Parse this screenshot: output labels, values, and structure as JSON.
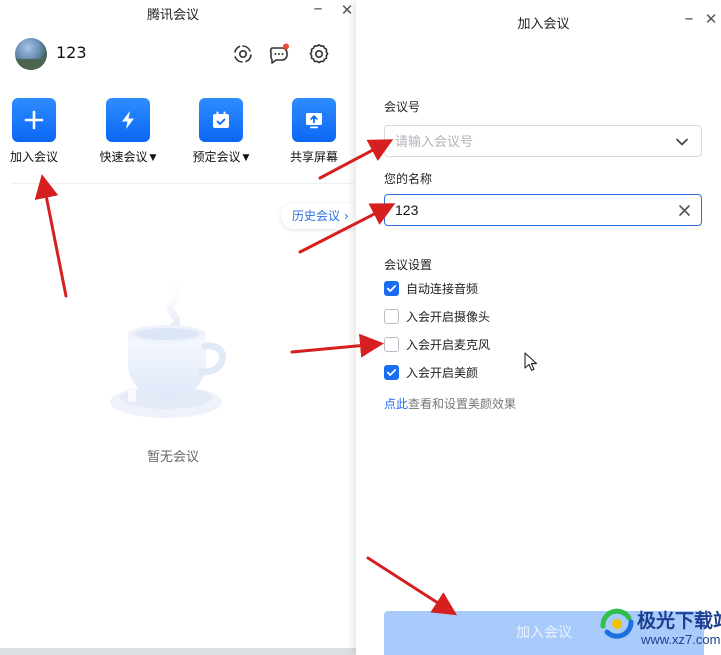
{
  "main_window": {
    "title": "腾讯会议",
    "username": "123",
    "quick_actions": {
      "join": "加入会议",
      "quick": "快速会议",
      "schedule": "预定会议",
      "share": "共享屏幕"
    },
    "history_button": "历史会议",
    "empty_state": "暂无会议"
  },
  "join_dialog": {
    "title": "加入会议",
    "meeting_number_label": "会议号",
    "meeting_number_placeholder": "请输入会议号",
    "meeting_number_value": "",
    "name_label": "您的名称",
    "name_value": "123",
    "settings_label": "会议设置",
    "options": [
      {
        "label": "自动连接音频",
        "checked": true
      },
      {
        "label": "入会开启摄像头",
        "checked": false
      },
      {
        "label": "入会开启麦克风",
        "checked": false
      },
      {
        "label": "入会开启美颜",
        "checked": true
      }
    ],
    "beauty_link_prefix": "点此",
    "beauty_link_rest": "查看和设置美颜效果",
    "join_button": "加入会议"
  },
  "watermark": {
    "name": "极光下载站",
    "url": "www.xz7.com"
  },
  "colors": {
    "accent": "#1a6cf2",
    "tile_blue": "#0a67f5",
    "join_button_disabled": "#a9cbfb",
    "annotation_arrow": "#e02020"
  }
}
